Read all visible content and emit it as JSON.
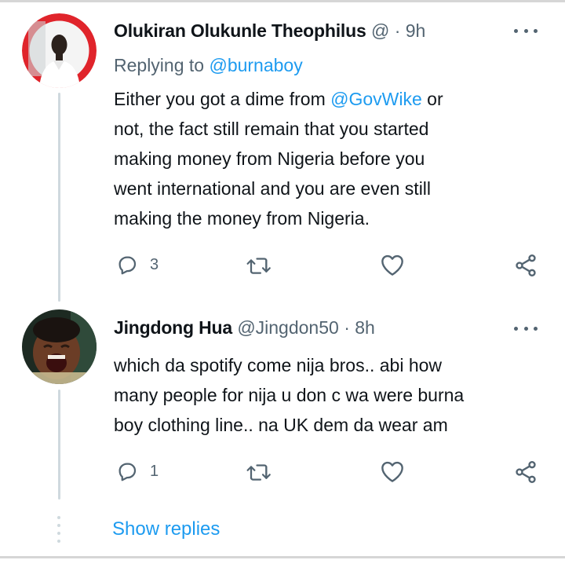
{
  "tweets": [
    {
      "name": "Olukiran Olukunle Theophilus",
      "handle": "@",
      "separator": "·",
      "time": "9h",
      "replying_prefix": "Replying to",
      "replying_handle": "@burnaboy",
      "text_before_mention": "Either you got a dime from",
      "mention": "@GovWike",
      "text_lines": [
        " or",
        "not, the fact still remain that you started",
        "making money from Nigeria before you",
        "went international and you are even still",
        "making the money from Nigeria."
      ],
      "reply_count": "3",
      "avatar_icon": "user-avatar-man-white-shirt"
    },
    {
      "name": "Jingdong Hua",
      "handle": "@Jingdon50",
      "separator": "·",
      "time": "8h",
      "text_lines": [
        "which da spotify come nija bros.. abi how",
        "many people for nija u don c wa were burna",
        "boy clothing line.. na UK dem da wear am"
      ],
      "reply_count": "1",
      "avatar_icon": "user-avatar-laughing-face"
    }
  ],
  "show_replies": "Show replies",
  "icons": {
    "reply": "reply-bubble-icon",
    "retweet": "retweet-icon",
    "like": "heart-icon",
    "share": "share-icon",
    "more": "more-dots-icon"
  },
  "colors": {
    "link": "#1d9bf0",
    "muted": "#536471",
    "text": "#0f1419",
    "avatar_ring": "#e0242b"
  }
}
